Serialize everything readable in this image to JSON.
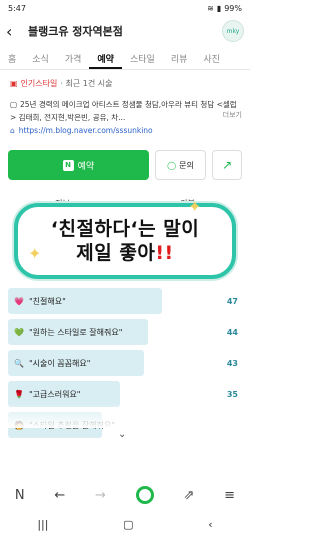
{
  "status_bar": {
    "time": "5:47",
    "battery": "99%"
  },
  "header": {
    "title": "블랭크유 정자역본점",
    "avatar_text": "mky"
  },
  "tabs": [
    "홈",
    "소식",
    "가격",
    "예약",
    "스타일",
    "리뷰",
    "사진"
  ],
  "active_tab_index": 3,
  "hot": {
    "label": "인기스타일",
    "suffix": "· 최근 1건 시술"
  },
  "description": "25년 경력의 메이크업 아티스트 정샘물 청담,아우라 뷰티 청담 <셀럽> 김태희, 전지현,박은빈, 공유, 차...",
  "more_label": "더보기",
  "link_text": "https://m.blog.naver.com/sssunkino",
  "buttons": {
    "reserve": "예약",
    "reserve_badge": "N",
    "inquiry": "문의"
  },
  "subtabs": [
    "정보",
    "리뷰"
  ],
  "bubble": {
    "line1": "‘친절하다‘는 말이",
    "line2": "제일 좋아",
    "mark": "!!"
  },
  "reviews": [
    {
      "emoji": "💗",
      "text": "\"친절해요\"",
      "count": "47",
      "ratio": 0.66,
      "emoji_color": "#e0437a"
    },
    {
      "emoji": "💚",
      "text": "\"원하는 스타일로 잘해줘요\"",
      "count": "44",
      "ratio": 0.6,
      "emoji_color": "#1fb84a"
    },
    {
      "emoji": "🔍",
      "text": "\"시술이 꼼꼼해요\"",
      "count": "43",
      "ratio": 0.58,
      "emoji_color": "#888"
    },
    {
      "emoji": "🌹",
      "text": "\"고급스러워요\"",
      "count": "35",
      "ratio": 0.48,
      "emoji_color": "#c22"
    },
    {
      "emoji": "🧑",
      "text": "\"스타일 추천을 잘해줘요\"",
      "count": "",
      "ratio": 0.4,
      "emoji_color": "#d9a"
    }
  ]
}
